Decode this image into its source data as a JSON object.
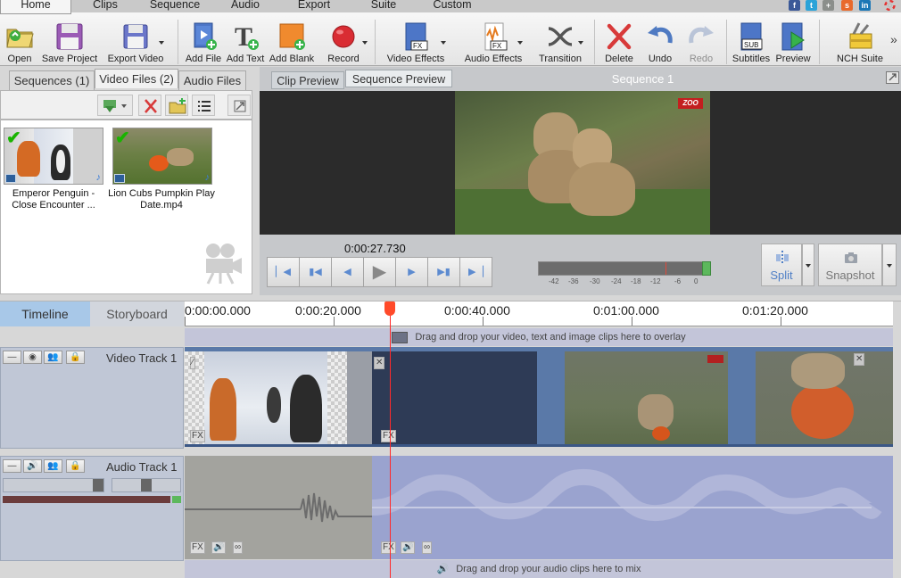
{
  "menu": {
    "tabs": [
      "Home",
      "Clips",
      "Sequence",
      "Audio",
      "Export",
      "Suite",
      "Custom"
    ]
  },
  "toolbar": {
    "open": "Open",
    "save_project": "Save Project",
    "export_video": "Export Video",
    "add_file": "Add File",
    "add_text": "Add Text",
    "add_blank": "Add Blank",
    "record": "Record",
    "video_effects": "Video Effects",
    "audio_effects": "Audio Effects",
    "transition": "Transition",
    "delete": "Delete",
    "undo": "Undo",
    "redo": "Redo",
    "subtitles": "Subtitles",
    "preview": "Preview",
    "nch_suite": "NCH Suite",
    "more": "»",
    "fx_badge": "FX",
    "sub_badge": "SUB"
  },
  "media_panel": {
    "tabs": [
      "Sequences (1)",
      "Video Files (2)",
      "Audio Files"
    ],
    "files": [
      {
        "name": "Emperor Penguin - Close Encounter ...",
        "checked": true
      },
      {
        "name": "Lion Cubs Pumpkin Play Date.mp4",
        "checked": true
      }
    ]
  },
  "preview": {
    "tabs": [
      "Clip Preview",
      "Sequence Preview"
    ],
    "title": "Sequence 1",
    "watermark": "ZOO",
    "time": "0:00:27.730",
    "meter_scale": [
      "-42",
      "-36",
      "-30",
      "-24",
      "-18",
      "-12",
      "-6",
      "0"
    ],
    "split": "Split",
    "snapshot": "Snapshot"
  },
  "timeline": {
    "tabs": [
      "Timeline",
      "Storyboard"
    ],
    "ruler": [
      "0:00:00.000",
      "0:00:20.000",
      "0:00:40.000",
      "0:01:00.000",
      "0:01:20.000"
    ],
    "overlay_hint": "Drag and drop your video, text and image clips here to overlay",
    "video_track": "Video Track 1",
    "audio_track": "Audio Track 1",
    "audio_hint": "Drag and drop your audio clips here to mix",
    "fx": "FX"
  },
  "colors": {
    "accent": "#5a79a8",
    "playhead": "#ff2a2a",
    "active_tab": "#a8c8e8"
  }
}
